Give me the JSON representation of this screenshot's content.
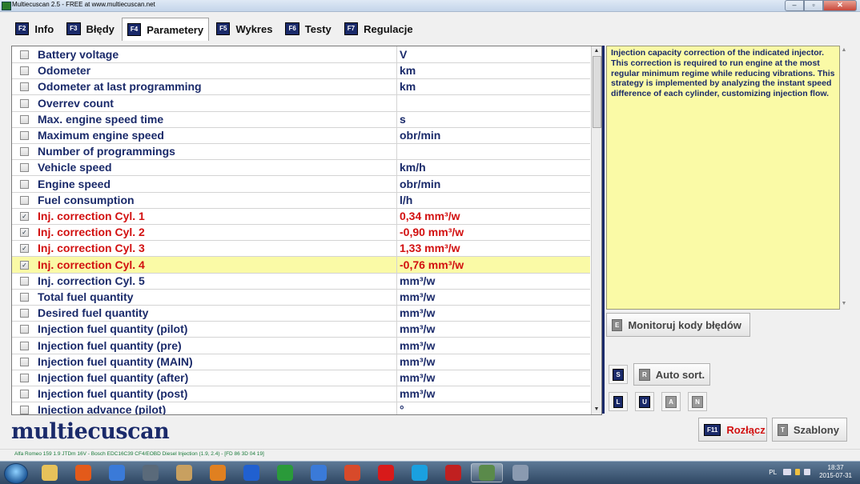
{
  "window": {
    "title": "Multiecuscan 2.5 - FREE at www.multiecuscan.net"
  },
  "tabs": [
    {
      "key": "F2",
      "label": "Info"
    },
    {
      "key": "F3",
      "label": "Błędy"
    },
    {
      "key": "F4",
      "label": "Parametery",
      "active": true
    },
    {
      "key": "F5",
      "label": "Wykres"
    },
    {
      "key": "F6",
      "label": "Testy"
    },
    {
      "key": "F7",
      "label": "Regulacje"
    }
  ],
  "parameters": [
    {
      "name": "Battery voltage",
      "value": "V",
      "checked": false
    },
    {
      "name": "Odometer",
      "value": "km",
      "checked": false
    },
    {
      "name": "Odometer at last programming",
      "value": "km",
      "checked": false
    },
    {
      "name": "Overrev count",
      "value": "",
      "checked": false
    },
    {
      "name": "Max. engine speed time",
      "value": "s",
      "checked": false
    },
    {
      "name": "Maximum engine speed",
      "value": "obr/min",
      "checked": false
    },
    {
      "name": "Number of programmings",
      "value": "",
      "checked": false
    },
    {
      "name": "Vehicle speed",
      "value": "km/h",
      "checked": false
    },
    {
      "name": "Engine speed",
      "value": "obr/min",
      "checked": false
    },
    {
      "name": "Fuel consumption",
      "value": "l/h",
      "checked": false
    },
    {
      "name": "Inj. correction Cyl. 1",
      "value": "0,34 mm³/w",
      "checked": true,
      "active": true
    },
    {
      "name": "Inj. correction Cyl. 2",
      "value": "-0,90 mm³/w",
      "checked": true,
      "active": true
    },
    {
      "name": "Inj. correction Cyl. 3",
      "value": "1,33 mm³/w",
      "checked": true,
      "active": true
    },
    {
      "name": "Inj. correction Cyl. 4",
      "value": "-0,76 mm³/w",
      "checked": true,
      "active": true,
      "selected": true
    },
    {
      "name": "Inj. correction Cyl. 5",
      "value": "mm³/w",
      "checked": false
    },
    {
      "name": "Total fuel quantity",
      "value": "mm³/w",
      "checked": false
    },
    {
      "name": "Desired fuel quantity",
      "value": "mm³/w",
      "checked": false
    },
    {
      "name": "Injection fuel quantity (pilot)",
      "value": "mm³/w",
      "checked": false
    },
    {
      "name": "Injection fuel quantity (pre)",
      "value": "mm³/w",
      "checked": false
    },
    {
      "name": "Injection fuel quantity (MAIN)",
      "value": "mm³/w",
      "checked": false
    },
    {
      "name": "Injection fuel quantity (after)",
      "value": "mm³/w",
      "checked": false
    },
    {
      "name": "Injection fuel quantity (post)",
      "value": "mm³/w",
      "checked": false
    },
    {
      "name": "Injection advance (pilot)",
      "value": "°",
      "checked": false
    }
  ],
  "description": "Injection capacity correction of the indicated injector. This correction is required to run engine at the most regular minimum regime while reducing vibrations. This strategy is implemented by analyzing the instant speed difference of each cylinder, customizing injection flow.",
  "buttons": {
    "monitor": {
      "key": "E",
      "label": "Monitoruj kody błędów"
    },
    "autosort": {
      "key": "R",
      "label": "Auto sort."
    },
    "s_key": "S",
    "l_key": "L",
    "u_key": "U",
    "a_key": "A",
    "n_key": "N",
    "disconnect": {
      "key": "F11",
      "label": "Rozłącz"
    },
    "templates": {
      "key": "T",
      "label": "Szablony"
    }
  },
  "logo": "multiecuscan",
  "status": "Alfa Romeo 159 1.9 JTDm 16V - Bosch EDC16C39 CF4/EOBD Diesel Injection (1.9, 2.4) - [FD 86 3D 04 19]",
  "colors": {
    "accent": "#1a2a6a",
    "active_param": "#d21010",
    "highlight": "#fafaa6"
  },
  "taskbar": {
    "icons": [
      "start-orb",
      "explorer",
      "firefox",
      "media-player",
      "movie-maker",
      "pencil-app",
      "tools-app",
      "flash-app",
      "utorrent",
      "teamviewer",
      "chrome",
      "opera",
      "skype",
      "car-app",
      "multiecuscan",
      "monitor-app"
    ],
    "lang": "PL",
    "time": "18:37",
    "date": "2015-07-31"
  }
}
